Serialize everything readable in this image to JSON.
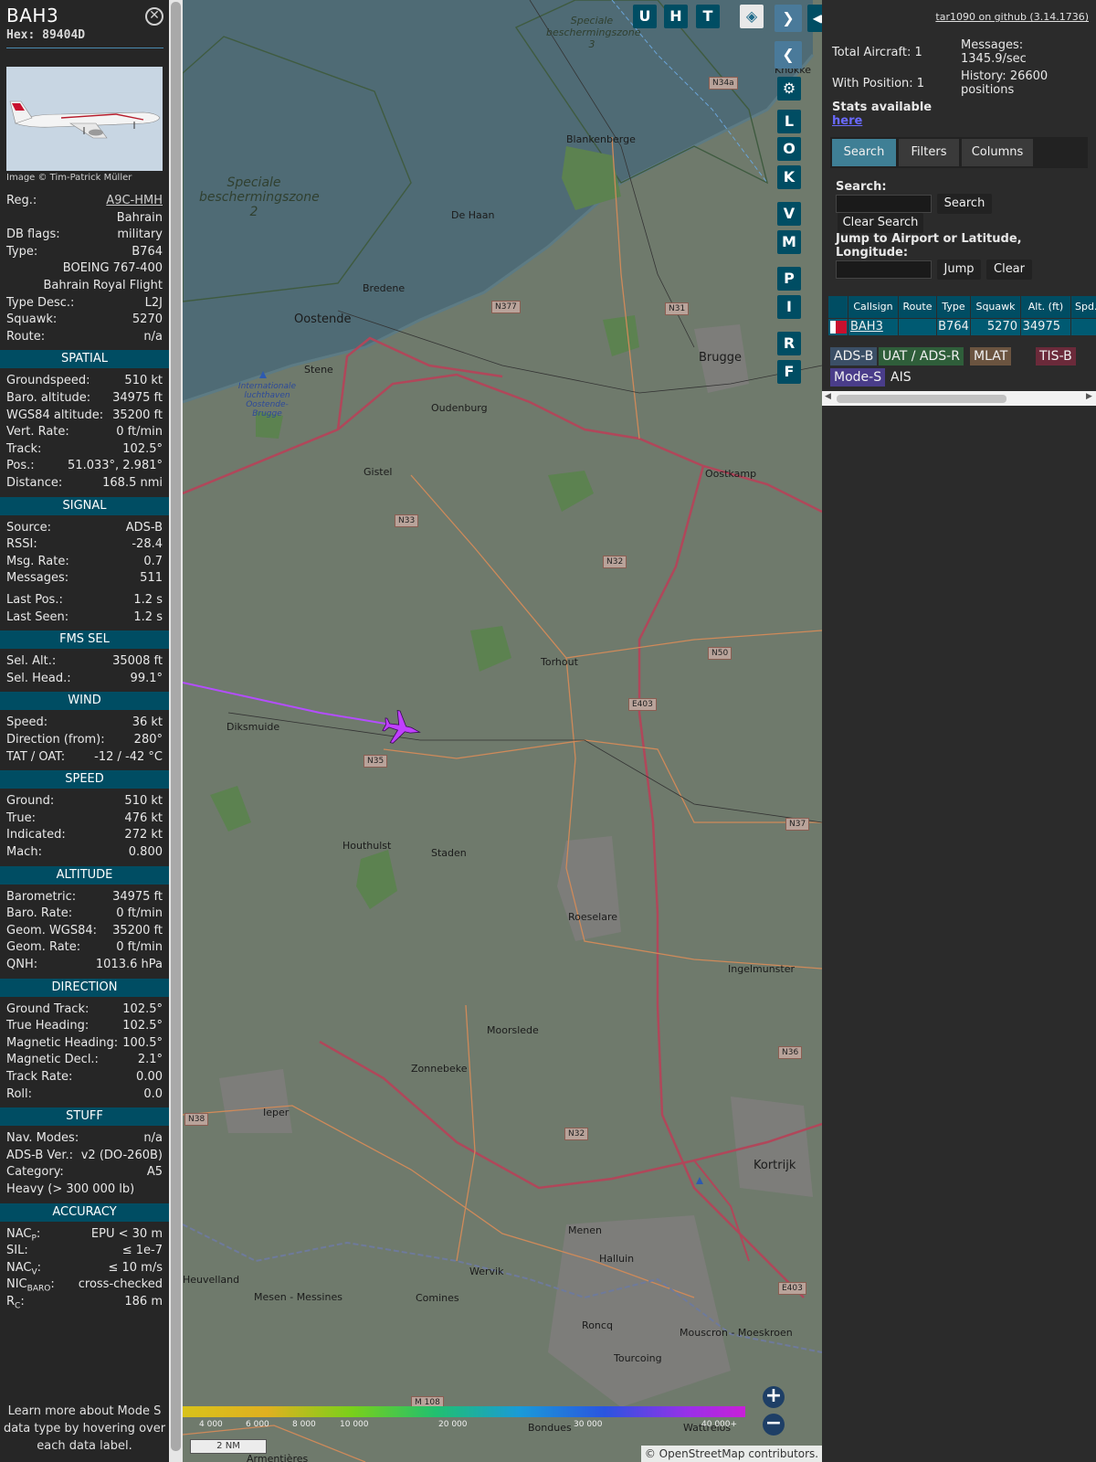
{
  "info": {
    "callsign": "BAH3",
    "hex": "Hex: 89404D",
    "photo_credit": "Image © Tim-Patrick Müller",
    "airline_name": "Bahrain",
    "basic": [
      {
        "label": "Reg.:",
        "value": "A9C-HMH",
        "link": true
      },
      {
        "label": "",
        "value": "Bahrain"
      },
      {
        "label": "DB flags:",
        "value": "military"
      },
      {
        "label": "Type:",
        "value": "B764"
      },
      {
        "label": "",
        "value": "BOEING 767-400"
      },
      {
        "label": "",
        "value": "Bahrain Royal Flight"
      },
      {
        "label": "Type Desc.:",
        "value": "L2J"
      },
      {
        "label": "Squawk:",
        "value": "5270"
      },
      {
        "label": "Route:",
        "value": "n/a"
      }
    ],
    "sections": {
      "spatial": "SPATIAL",
      "signal": "SIGNAL",
      "fms": "FMS SEL",
      "wind": "WIND",
      "speed": "SPEED",
      "altitude": "ALTITUDE",
      "direction": "DIRECTION",
      "stuff": "STUFF",
      "accuracy": "ACCURACY"
    },
    "spatial": [
      {
        "label": "Groundspeed:",
        "value": "510 kt"
      },
      {
        "label": "Baro. altitude:",
        "value": "34975 ft"
      },
      {
        "label": "WGS84 altitude:",
        "value": "35200 ft"
      },
      {
        "label": "Vert. Rate:",
        "value": "0 ft/min"
      },
      {
        "label": "Track:",
        "value": "102.5°"
      },
      {
        "label": "Pos.:",
        "value": "51.033°, 2.981°"
      },
      {
        "label": "Distance:",
        "value": "168.5 nmi"
      }
    ],
    "signal": [
      {
        "label": "Source:",
        "value": "ADS-B"
      },
      {
        "label": "RSSI:",
        "value": "-28.4"
      },
      {
        "label": "Msg. Rate:",
        "value": "0.7"
      },
      {
        "label": "Messages:",
        "value": "511"
      },
      {
        "label": "Last Pos.:",
        "value": "1.2 s"
      },
      {
        "label": "Last Seen:",
        "value": "1.2 s"
      }
    ],
    "fms": [
      {
        "label": "Sel. Alt.:",
        "value": "35008 ft"
      },
      {
        "label": "Sel. Head.:",
        "value": "99.1°"
      }
    ],
    "wind": [
      {
        "label": "Speed:",
        "value": "36 kt"
      },
      {
        "label": "Direction (from):",
        "value": "280°"
      },
      {
        "label": "TAT / OAT:",
        "value": "-12 / -42 °C"
      }
    ],
    "speed": [
      {
        "label": "Ground:",
        "value": "510 kt"
      },
      {
        "label": "True:",
        "value": "476 kt"
      },
      {
        "label": "Indicated:",
        "value": "272 kt"
      },
      {
        "label": "Mach:",
        "value": "0.800"
      }
    ],
    "altitude": [
      {
        "label": "Barometric:",
        "value": "34975 ft"
      },
      {
        "label": "Baro. Rate:",
        "value": "0 ft/min"
      },
      {
        "label": "Geom. WGS84:",
        "value": "35200 ft"
      },
      {
        "label": "Geom. Rate:",
        "value": "0 ft/min"
      },
      {
        "label": "QNH:",
        "value": "1013.6 hPa"
      }
    ],
    "direction": [
      {
        "label": "Ground Track:",
        "value": "102.5°"
      },
      {
        "label": "True Heading:",
        "value": "102.5°"
      },
      {
        "label": "Magnetic Heading:",
        "value": "100.5°"
      },
      {
        "label": "Magnetic Decl.:",
        "value": "2.1°"
      },
      {
        "label": "Track Rate:",
        "value": "0.00"
      },
      {
        "label": "Roll:",
        "value": "0.0"
      }
    ],
    "stuff": [
      {
        "label": "Nav. Modes:",
        "value": "n/a"
      },
      {
        "label": "ADS-B Ver.:",
        "value": "v2 (DO-260B)"
      },
      {
        "label": "Category:",
        "value": "A5"
      },
      {
        "label": "Heavy (> 300 000 lb)",
        "value": ""
      }
    ],
    "accuracy": [
      {
        "label": "NAC",
        "sub": "P",
        "value": "EPU < 30 m"
      },
      {
        "label": "SIL:",
        "value": "≤ 1e-7"
      },
      {
        "label": "NAC",
        "sub": "V",
        "value": "≤ 10 m/s"
      },
      {
        "label": "NIC",
        "sub": "BARO",
        "value": "cross-checked"
      },
      {
        "label": "R",
        "sub": "C",
        "value": "186 m"
      }
    ],
    "note": "Learn more about Mode S data type by hovering over each data label."
  },
  "map": {
    "top_buttons": [
      "U",
      "H",
      "T"
    ],
    "side_buttons": [
      "L",
      "O",
      "K",
      "V",
      "M",
      "P",
      "I",
      "R",
      "F"
    ],
    "labels": {
      "zone3": "Speciale beschermingszone 3",
      "zone2": "Speciale beschermingszone 2",
      "airport": "Internationale luchthaven Oostende-Brugge",
      "cities": [
        "Blankenberge",
        "De Haan",
        "Bredene",
        "Oostende",
        "Stene",
        "Oudenburg",
        "Brugge",
        "Oostkamp",
        "Gistel",
        "Torhout",
        "Diksmuide",
        "Houthulst",
        "Staden",
        "Roeselare",
        "Ingelmunster",
        "Moorslede",
        "Zonnebeke",
        "Ieper",
        "Kortrijk",
        "Menen",
        "Halluin",
        "Wervik",
        "Comines",
        "Heuvelland",
        "Mesen - Messines",
        "Roncq",
        "Mouscron - Moeskroen",
        "Tourcoing",
        "Bondues",
        "Wattrelos",
        "Armentières",
        "Knokke"
      ],
      "roads": [
        "N34a",
        "N377",
        "N31",
        "N33",
        "N32",
        "N50",
        "E403",
        "N35",
        "N37",
        "N36",
        "N38",
        "N32",
        "E403",
        "M 108"
      ]
    },
    "altitude_legend": [
      "4 000",
      "6 000",
      "8 000",
      "10 000",
      "20 000",
      "30 000",
      "40 000+"
    ],
    "scale": "2 NM",
    "attribution": "© OpenStreetMap contributors.",
    "colors": {
      "track": "#b44dff",
      "aircraft": "#c040ff",
      "nav_button": "#004d63"
    }
  },
  "sidebar": {
    "github": "tar1090 on github (3.14.1736)",
    "total_aircraft": "Total Aircraft: 1",
    "with_position": "With Position: 1",
    "messages": "Messages: 1345.9/sec",
    "history": "History: 26600 positions",
    "stats_label": "Stats available",
    "stats_link": "here",
    "tabs": [
      "Search",
      "Filters",
      "Columns"
    ],
    "search_label": "Search:",
    "search_btn": "Search",
    "clear_search_btn": "Clear Search",
    "jump_label": "Jump to Airport or Latitude, Longitude:",
    "jump_btn": "Jump",
    "clear_btn": "Clear",
    "table": {
      "headers": [
        "Callsign",
        "Route",
        "Type",
        "Squawk",
        "Alt. (ft)",
        "Spd."
      ],
      "row": {
        "callsign": "BAH3",
        "route": "",
        "type": "B764",
        "squawk": "5270",
        "alt": "34975"
      }
    },
    "sources": [
      {
        "label": "ADS-B",
        "color": "#3b4f66"
      },
      {
        "label": "UAT / ADS-R",
        "color": "#2f5e3a"
      },
      {
        "label": "MLAT",
        "color": "#6b5440"
      },
      {
        "label": "TIS-B",
        "color": "#6b2a3a"
      },
      {
        "label": "Mode-S",
        "color": "#4a3d8a"
      },
      {
        "label": "AIS",
        "color": "#2b2b2b"
      }
    ]
  }
}
